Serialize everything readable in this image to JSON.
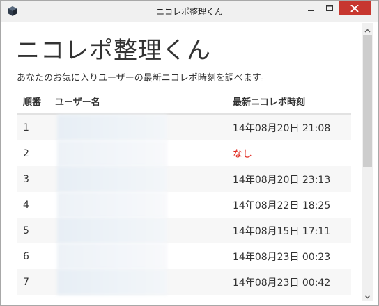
{
  "window": {
    "title": "ニコレポ整理くん",
    "app_icon": "cube-icon",
    "controls": [
      "minimize-icon",
      "maximize-icon",
      "close-icon"
    ],
    "close_color": "#c7372f"
  },
  "page": {
    "heading": "ニコレポ整理くん",
    "description": "あなたのお気に入りユーザーの最新ニコレポ時刻を調べます。"
  },
  "table": {
    "headers": {
      "number": "順番",
      "user": "ユーザー名",
      "latest": "最新ニコレポ時刻"
    },
    "rows": [
      {
        "number": "1",
        "user": "",
        "latest": "14年08月20日 21:08"
      },
      {
        "number": "2",
        "user": "",
        "latest": "なし"
      },
      {
        "number": "3",
        "user": "",
        "latest": "14年08月20日 23:13"
      },
      {
        "number": "4",
        "user": "",
        "latest": "14年08月22日 18:25"
      },
      {
        "number": "5",
        "user": "",
        "latest": "14年08月15日 17:11"
      },
      {
        "number": "6",
        "user": "",
        "latest": "14年08月23日 00:23"
      },
      {
        "number": "7",
        "user": "",
        "latest": "14年08月23日 00:42"
      }
    ],
    "none_color": "#e0281e"
  }
}
